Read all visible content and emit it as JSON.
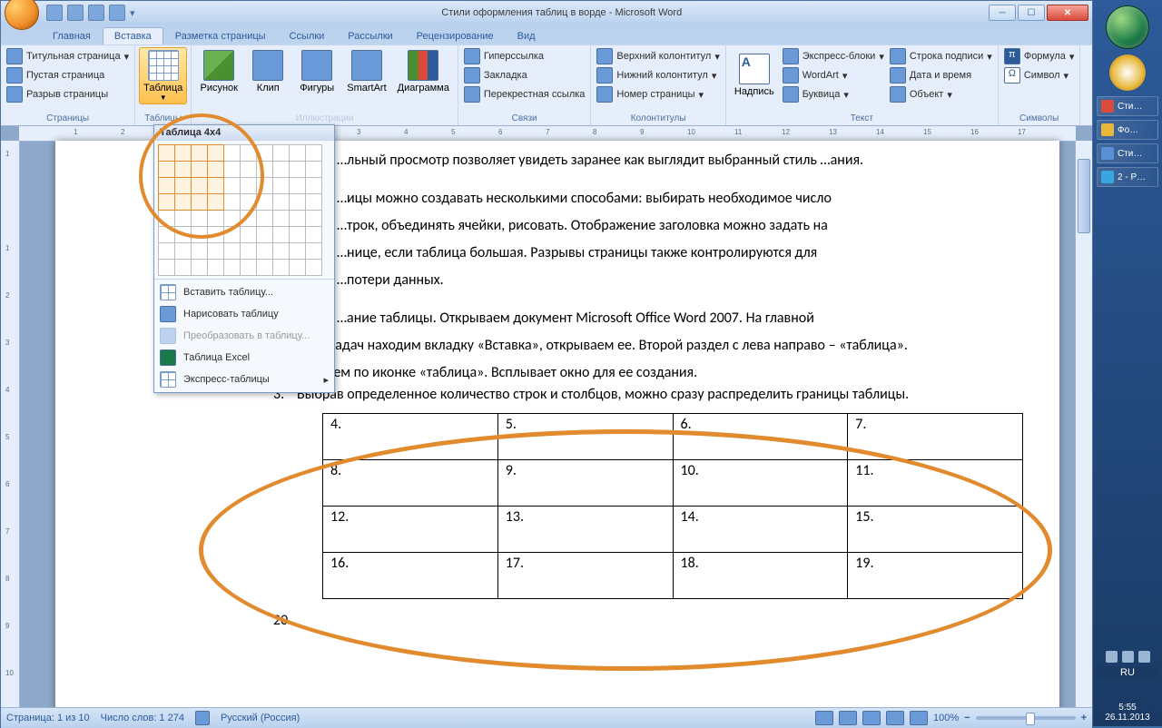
{
  "title": "Стили оформления таблиц в ворде - Microsoft Word",
  "qat": {
    "save": "save",
    "undo": "undo",
    "redo": "redo",
    "spell": "spell"
  },
  "tabs": [
    "Главная",
    "Вставка",
    "Разметка страницы",
    "Ссылки",
    "Рассылки",
    "Рецензирование",
    "Вид"
  ],
  "active_tab": 1,
  "ribbon": {
    "pages": {
      "label": "Страницы",
      "title_page": "Титульная страница",
      "blank": "Пустая страница",
      "break": "Разрыв страницы"
    },
    "tables": {
      "label": "Таблицы",
      "btn": "Таблица"
    },
    "illustr": {
      "label": "Иллюстрации",
      "pic": "Рисунок",
      "clip": "Клип",
      "shapes": "Фигуры",
      "smartart": "SmartArt",
      "chart": "Диаграмма"
    },
    "links": {
      "label": "Связи",
      "hyper": "Гиперссылка",
      "bookmark": "Закладка",
      "xref": "Перекрестная ссылка"
    },
    "headers": {
      "label": "Колонтитулы",
      "top": "Верхний колонтитул",
      "bottom": "Нижний колонтитул",
      "num": "Номер страницы"
    },
    "text": {
      "label": "Текст",
      "textbox": "Надпись",
      "parts": "Экспресс-блоки",
      "wordart": "WordArt",
      "dropcap": "Буквица",
      "sig": "Строка подписи",
      "date": "Дата и время",
      "obj": "Объект"
    },
    "symbols": {
      "label": "Символы",
      "formula": "Формула",
      "symbol": "Символ"
    }
  },
  "table_dropdown": {
    "header": "Таблица 4x4",
    "insert": "Вставить таблицу...",
    "draw": "Нарисовать таблицу",
    "convert": "Преобразовать в таблицу...",
    "excel": "Таблица Excel",
    "express": "Экспресс-таблицы"
  },
  "doc": {
    "p1": "…льный просмотр позволяет увидеть заранее как выглядит выбранный стиль …ания.",
    "p2a": "…ицы можно создавать несколькими способами: выбирать необходимое число",
    "p2b": "…трок, объединять ячейки, рисовать. Отображение заголовка можно задать на",
    "p2c": "…нице, если таблица большая. Разрывы страницы также контролируются для",
    "p2d": "…потери данных.",
    "li1a": "…ание таблицы. Открываем документ  Microsoft Office Word 2007. На главной",
    "li1b": "…ли задач находим вкладку «Вставка», открываем ее.  Второй раздел с лева направо – «таблица».",
    "li2": "Кликаем по иконке «таблица». Всплывает окно для ее создания.",
    "li3": "Выбрав определенное количество строк и столбцов, можно сразу распределить границы таблицы.",
    "cells": [
      [
        "4.",
        "5.",
        "6.",
        "7."
      ],
      [
        "8.",
        "9.",
        "10.",
        "11."
      ],
      [
        "12.",
        "13.",
        "14.",
        "15."
      ],
      [
        "16.",
        "17.",
        "18.",
        "19."
      ]
    ],
    "after": "20."
  },
  "status": {
    "page": "Страница: 1 из 10",
    "words": "Число слов: 1 274",
    "lang": "Русский (Россия)",
    "zoom": "100%"
  },
  "sidebar": {
    "items": [
      {
        "color": "#d94b3b",
        "label": "Сти…"
      },
      {
        "color": "#e8b83c",
        "label": "Фо…"
      },
      {
        "color": "#5a8fd6",
        "label": "Сти…"
      },
      {
        "color": "#3aa6e0",
        "label": "2 - P…"
      }
    ],
    "lang": "RU",
    "time": "5:55",
    "date": "26.11.2013"
  },
  "ruler_h": [
    "1",
    "2",
    "1",
    "",
    "1",
    "2",
    "3",
    "4",
    "5",
    "6",
    "7",
    "8",
    "9",
    "10",
    "11",
    "12",
    "13",
    "14",
    "15",
    "16",
    "17"
  ],
  "ruler_v": [
    "1",
    "",
    "1",
    "2",
    "3",
    "4",
    "5",
    "6",
    "7",
    "8",
    "9",
    "10"
  ]
}
